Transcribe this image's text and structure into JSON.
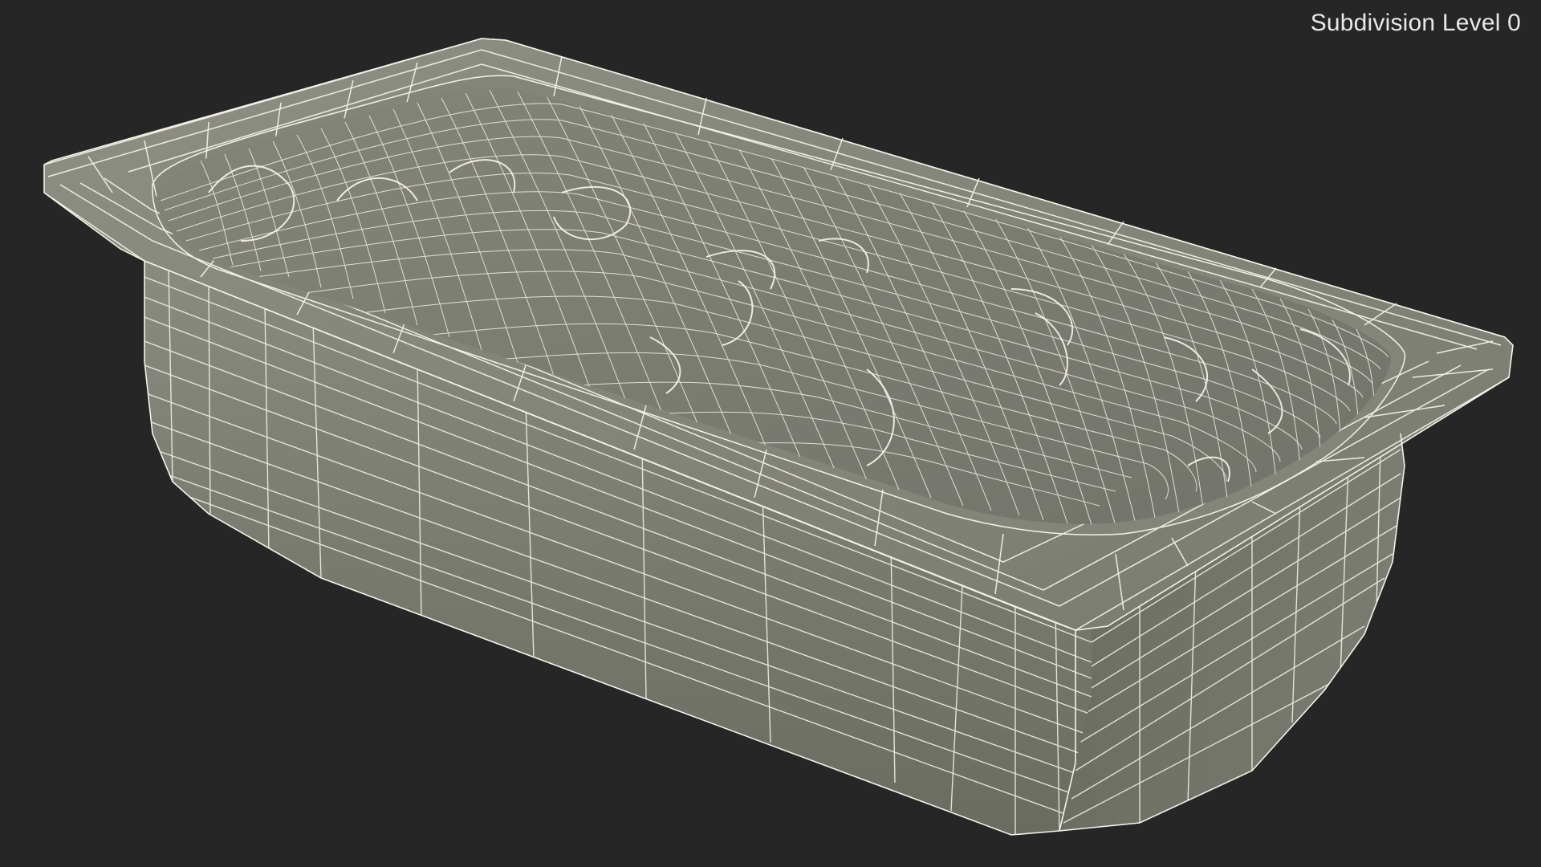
{
  "viewport": {
    "label": "Subdivision Level 0",
    "background_color": "#262626",
    "label_color": "#e8e8e8"
  },
  "model": {
    "subject": "tub-wireframe",
    "surface_color": "#7c7d72",
    "wire_color": "#f4f2e8"
  }
}
